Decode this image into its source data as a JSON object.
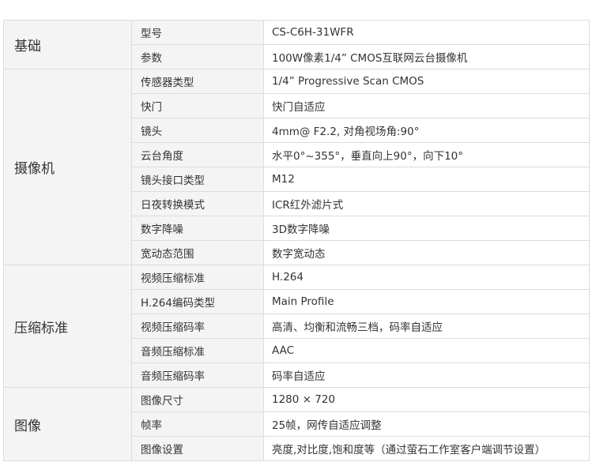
{
  "groups": [
    {
      "category": "基础",
      "rows": [
        {
          "name": "型号",
          "value": "CS-C6H-31WFR"
        },
        {
          "name": "参数",
          "value": "100W像素1/4” CMOS互联网云台摄像机"
        }
      ]
    },
    {
      "category": "摄像机",
      "rows": [
        {
          "name": "传感器类型",
          "value": "1/4” Progressive Scan CMOS"
        },
        {
          "name": "快门",
          "value": "快门自适应"
        },
        {
          "name": "镜头",
          "value": "4mm@ F2.2, 对角视场角:90°"
        },
        {
          "name": "云台角度",
          "value": "水平0°~355°，垂直向上90°，向下10°"
        },
        {
          "name": "镜头接口类型",
          "value": "M12"
        },
        {
          "name": "日夜转换模式",
          "value": "ICR红外滤片式"
        },
        {
          "name": "数字降噪",
          "value": "3D数字降噪"
        },
        {
          "name": "宽动态范围",
          "value": "数字宽动态"
        }
      ]
    },
    {
      "category": "压缩标准",
      "rows": [
        {
          "name": "视频压缩标准",
          "value": "H.264"
        },
        {
          "name": "H.264编码类型",
          "value": "Main Profile"
        },
        {
          "name": "视频压缩码率",
          "value": "高清、均衡和流畅三档，码率自适应"
        },
        {
          "name": "音频压缩标准",
          "value": "AAC"
        },
        {
          "name": "音频压缩码率",
          "value": "码率自适应"
        }
      ]
    },
    {
      "category": "图像",
      "rows": [
        {
          "name": "图像尺寸",
          "value": "1280 × 720"
        },
        {
          "name": "帧率",
          "value": "25帧，网传自适应调整"
        },
        {
          "name": "图像设置",
          "value": "亮度,对比度,饱和度等（通过萤石工作室客户端调节设置）"
        }
      ]
    }
  ],
  "colors": {
    "border": "#dcdcdc",
    "shaded": "#f4f4f4",
    "text": "#333333"
  }
}
